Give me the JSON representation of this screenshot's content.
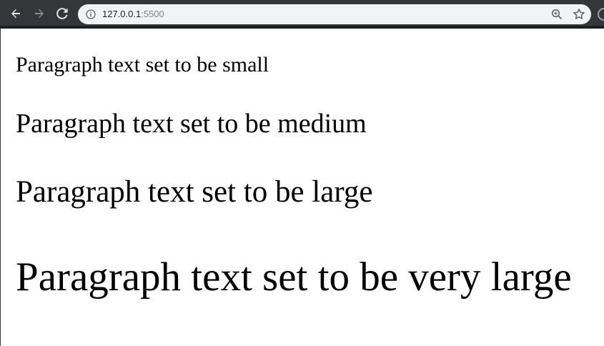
{
  "browser": {
    "url_host": "127.0.0.1",
    "url_port": ":5500",
    "icons": {
      "back": "back-arrow-icon",
      "forward": "forward-arrow-icon",
      "reload": "reload-icon",
      "info": "info-icon",
      "zoom": "zoom-in-icon",
      "bookmark": "star-icon"
    },
    "colors": {
      "toolbar": "#35363a",
      "omnibox": "#f1f3f4",
      "port_text": "#80868b"
    }
  },
  "page": {
    "paragraphs": [
      "Paragraph text set to be small",
      "Paragraph text set to be medium",
      "Paragraph text set to be large",
      "Paragraph text set to be very large"
    ]
  }
}
